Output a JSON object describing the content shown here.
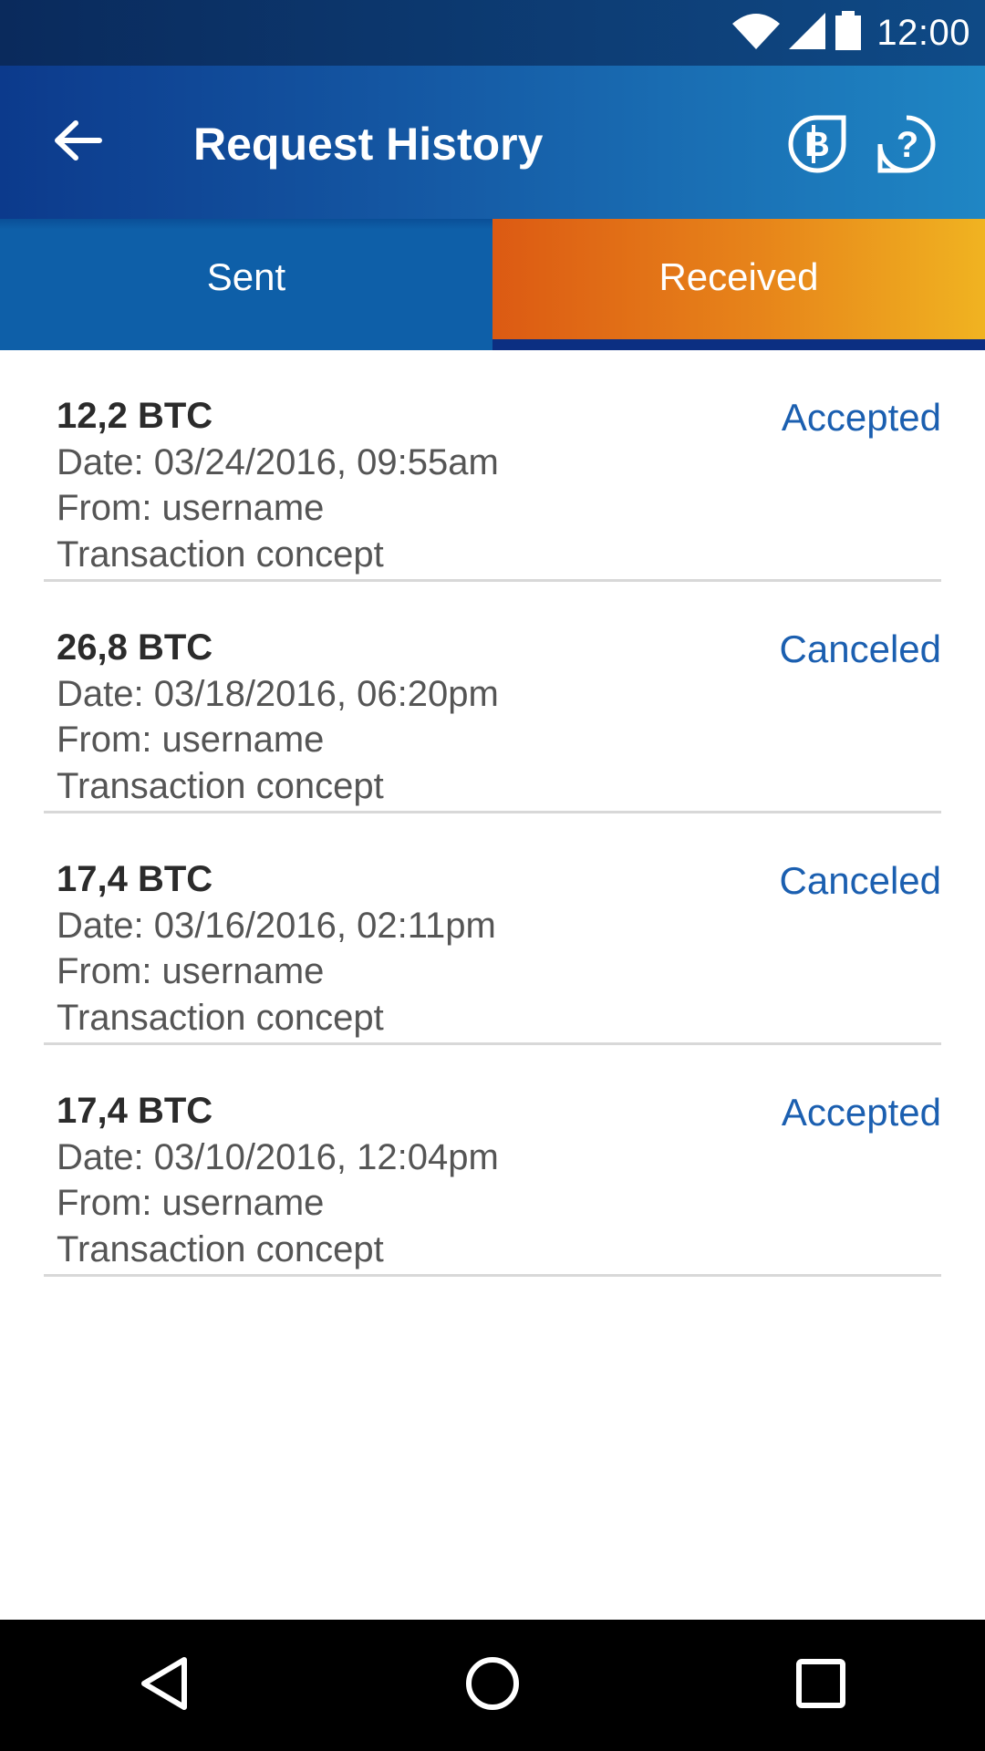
{
  "status_bar": {
    "time": "12:00"
  },
  "app_bar": {
    "title": "Request History",
    "back_icon": "arrow-left-icon",
    "bitcoin_icon": "bitcoin-icon",
    "help_icon": "help-icon"
  },
  "tabs": [
    {
      "label": "Sent",
      "selected": false
    },
    {
      "label": "Received",
      "selected": true
    }
  ],
  "requests": [
    {
      "amount": "12,2 BTC",
      "date": "Date: 03/24/2016, 09:55am",
      "from": "From: username",
      "concept": "Transaction concept",
      "status": "Accepted"
    },
    {
      "amount": "26,8 BTC",
      "date": "Date: 03/18/2016, 06:20pm",
      "from": "From: username",
      "concept": "Transaction concept",
      "status": "Canceled"
    },
    {
      "amount": "17,4 BTC",
      "date": "Date: 03/16/2016, 02:11pm",
      "from": "From: username",
      "concept": "Transaction concept",
      "status": "Canceled"
    },
    {
      "amount": "17,4 BTC",
      "date": "Date: 03/10/2016, 12:04pm",
      "from": "From: username",
      "concept": "Transaction concept",
      "status": "Accepted"
    }
  ],
  "colors": {
    "accent_blue": "#1b5fb0",
    "tab_received_start": "#dc5a13",
    "tab_received_end": "#f0b321",
    "app_bar_start": "#0c3a8c",
    "app_bar_end": "#1f86c4"
  },
  "nav_bar": {
    "back_icon": "nav-back-icon",
    "home_icon": "nav-home-icon",
    "recents_icon": "nav-recents-icon"
  }
}
